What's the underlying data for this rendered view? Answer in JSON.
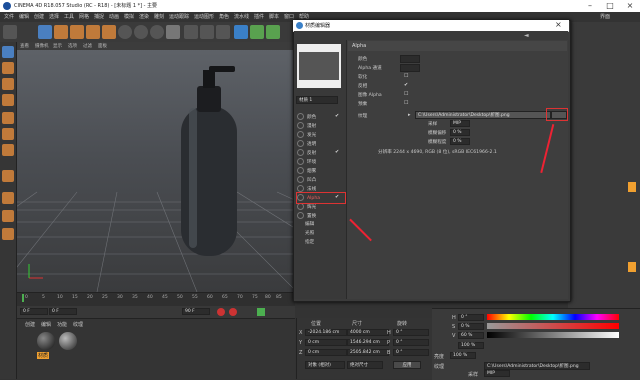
{
  "window": {
    "title": "CINEMA 4D R18.057 Studio (RC - R18) - [未标题 1 *] - 主要"
  },
  "menus": [
    "文件",
    "编辑",
    "创建",
    "选择",
    "工具",
    "网格",
    "捕捉",
    "动画",
    "模拟",
    "渲染",
    "雕刻",
    "运动跟踪",
    "运动图形",
    "角色",
    "流水线",
    "插件",
    "脚本",
    "窗口",
    "帮助"
  ],
  "layout_label": "界面",
  "viewport": {
    "menu": [
      "查看",
      "摄像机",
      "显示",
      "选项",
      "过滤",
      "面板"
    ]
  },
  "timeline": {
    "ticks": [
      "0",
      "5",
      "10",
      "15",
      "20",
      "25",
      "30",
      "35",
      "40",
      "45",
      "50",
      "55",
      "60",
      "65",
      "70",
      "75",
      "80",
      "85",
      "90"
    ],
    "frame_end": "90 F",
    "start": "0 F",
    "current": "0 F",
    "fps_end": "90 F"
  },
  "material_manager": {
    "menu": [
      "创建",
      "编辑",
      "功能",
      "纹理"
    ],
    "material": "材质"
  },
  "coordinates": {
    "headers": [
      "位置",
      "尺寸",
      "旋转"
    ],
    "rows": [
      {
        "axis": "X",
        "pos": "-2024.186 cm",
        "size": "4000 cm",
        "rlabel": "H",
        "rot": "0 °"
      },
      {
        "axis": "Y",
        "pos": "0 cm",
        "size": "1546.294 cm",
        "rlabel": "P",
        "rot": "0 °"
      },
      {
        "axis": "Z",
        "pos": "0 cm",
        "size": "2505.842 cm",
        "rlabel": "B",
        "rot": "0 °"
      }
    ],
    "mode_select": "对象 (相对)",
    "size_select": "绝对尺寸",
    "apply": "应用"
  },
  "dialog": {
    "title": "材质编辑器",
    "material_name": "材质 1",
    "section": "Alpha",
    "channels": [
      {
        "name": "颜色",
        "checked": true
      },
      {
        "name": "漫射",
        "checked": false
      },
      {
        "name": "发光",
        "checked": false
      },
      {
        "name": "透明",
        "checked": false
      },
      {
        "name": "反射",
        "checked": true
      },
      {
        "name": "环境",
        "checked": false
      },
      {
        "name": "烟雾",
        "checked": false
      },
      {
        "name": "凹凸",
        "checked": false
      },
      {
        "name": "法线",
        "checked": false
      },
      {
        "name": "Alpha",
        "checked": true
      },
      {
        "name": "辉光",
        "checked": false
      },
      {
        "name": "置换",
        "checked": false
      },
      {
        "name": "编辑",
        "checked": false
      },
      {
        "name": "光照",
        "checked": false
      },
      {
        "name": "指定",
        "checked": false
      }
    ],
    "props": {
      "color_label": "颜色",
      "delta_label": "Alpha 通道",
      "soft_label": "软化",
      "invert_label": "反相",
      "image_alpha_label": "图像 Alpha",
      "premultiply_label": "预乘",
      "texture_label": "纹理",
      "texture_path": "C:\\Users\\Administrator\\Desktop\\折图.png",
      "sampling_label": "采样",
      "sampling_value": "MIP",
      "blur_offset_label": "模糊偏移",
      "blur_offset_value": "0 %",
      "blur_scale_label": "模糊程度",
      "blur_scale_value": "0 %",
      "resolution": "分辨率 2244 x 4690, RGB (8 位), sRGB IEC61966-2.1"
    }
  },
  "color_panel": {
    "H": "0 °",
    "S": "0 %",
    "V": "60 %",
    "extra": "100 %",
    "brightness_label": "亮度",
    "brightness": "100 %",
    "texture_label": "纹理",
    "texture_path": "C:\\Users\\Administrator\\Desktop\\折图.png",
    "sampling_label": "采样",
    "sampling": "MIP",
    "blur_label": "模糊偏移",
    "blur": "0 %"
  },
  "colors": {
    "accent_red": "#e02a2a",
    "toolbar_orange": "#c07a3a",
    "dialog_bg": "#3b3b3b"
  }
}
